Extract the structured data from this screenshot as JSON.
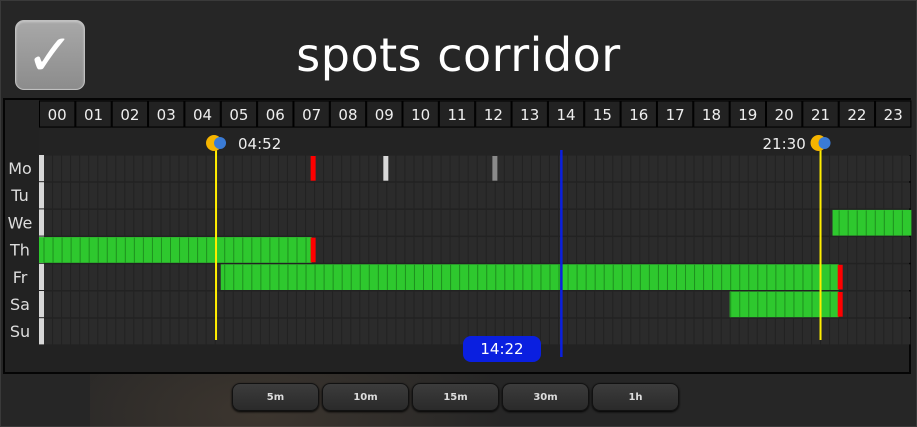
{
  "title": "spots corridor",
  "check_icon": "checkmark-icon",
  "hours": [
    "00",
    "01",
    "02",
    "03",
    "04",
    "05",
    "06",
    "07",
    "08",
    "09",
    "10",
    "11",
    "12",
    "13",
    "14",
    "15",
    "16",
    "17",
    "18",
    "19",
    "20",
    "21",
    "22",
    "23"
  ],
  "days": [
    "Mo",
    "Tu",
    "We",
    "Th",
    "Fr",
    "Sa",
    "Su"
  ],
  "sunrise": {
    "label": "04:52",
    "icon": "sunrise-icon",
    "hour": 4.87
  },
  "sunset": {
    "label": "21:30",
    "icon": "sunset-icon",
    "hour": 21.5
  },
  "now": {
    "label": "14:22",
    "hour": 14.37
  },
  "colors": {
    "on": "#2ec82e",
    "on_dark": "#1e8f1e",
    "end_marker": "#ff0000",
    "grid": "#1a1a1a",
    "cell": "#2b2b2b",
    "sun_line": "#ffee00",
    "now_line": "#0a1fe0"
  },
  "schedule": [
    {
      "day": "Mo",
      "blocks": [],
      "markers": [
        {
          "hour": 7.5,
          "color": "#ff0000"
        },
        {
          "hour": 9.5,
          "color": "#d9d9d9"
        },
        {
          "hour": 12.5,
          "color": "#8a8a8a"
        }
      ]
    },
    {
      "day": "Tu",
      "blocks": [],
      "markers": []
    },
    {
      "day": "We",
      "blocks": [
        {
          "start": 21.83,
          "end": 24.0
        }
      ],
      "markers": []
    },
    {
      "day": "Th",
      "blocks": [
        {
          "start": 0.0,
          "end": 7.5
        }
      ],
      "markers": [
        {
          "hour": 7.5,
          "color": "#ff0000"
        }
      ]
    },
    {
      "day": "Fr",
      "blocks": [
        {
          "start": 5.0,
          "end": 22.0
        }
      ],
      "markers": [
        {
          "hour": 22.0,
          "color": "#ff0000"
        }
      ]
    },
    {
      "day": "Sa",
      "blocks": [
        {
          "start": 19.0,
          "end": 22.0
        }
      ],
      "markers": [
        {
          "hour": 22.0,
          "color": "#ff0000"
        }
      ]
    },
    {
      "day": "Su",
      "blocks": [],
      "markers": []
    }
  ],
  "zoom_buttons": [
    "5m",
    "10m",
    "15m",
    "30m",
    "1h"
  ]
}
